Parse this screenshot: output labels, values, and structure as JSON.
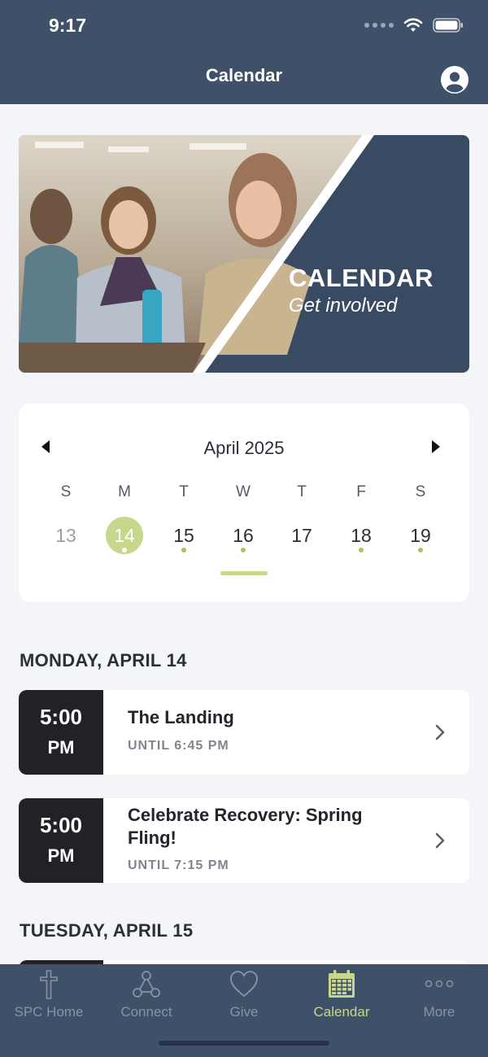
{
  "status_bar": {
    "time": "9:17"
  },
  "nav": {
    "title": "Calendar"
  },
  "banner": {
    "title": "CALENDAR",
    "subtitle": "Get involved"
  },
  "calendar": {
    "month_label": "April 2025",
    "weekdays": [
      "S",
      "M",
      "T",
      "W",
      "T",
      "F",
      "S"
    ],
    "days": [
      {
        "label": "13",
        "muted": true,
        "has_events": false,
        "selected": false
      },
      {
        "label": "14",
        "muted": false,
        "has_events": true,
        "selected": true
      },
      {
        "label": "15",
        "muted": false,
        "has_events": true,
        "selected": false
      },
      {
        "label": "16",
        "muted": false,
        "has_events": true,
        "selected": false
      },
      {
        "label": "17",
        "muted": false,
        "has_events": false,
        "selected": false
      },
      {
        "label": "18",
        "muted": false,
        "has_events": true,
        "selected": false
      },
      {
        "label": "19",
        "muted": false,
        "has_events": true,
        "selected": false
      }
    ]
  },
  "schedule": [
    {
      "day": "MONDAY, APRIL 14",
      "events": [
        {
          "time": "5:00",
          "ampm": "PM",
          "title": "The Landing",
          "until": "UNTIL 6:45 PM"
        },
        {
          "time": "5:00",
          "ampm": "PM",
          "title": "Celebrate Recovery: Spring Fling!",
          "until": "UNTIL 7:15 PM"
        }
      ]
    },
    {
      "day": "TUESDAY, APRIL 15",
      "events": []
    }
  ],
  "tabbar": {
    "items": [
      {
        "label": "SPC Home",
        "icon": "cross-icon",
        "active": false
      },
      {
        "label": "Connect",
        "icon": "connect-icon",
        "active": false
      },
      {
        "label": "Give",
        "icon": "heart-icon",
        "active": false
      },
      {
        "label": "Calendar",
        "icon": "calendar-icon",
        "active": true
      },
      {
        "label": "More",
        "icon": "more-icon",
        "active": false
      }
    ]
  },
  "colors": {
    "header_bg": "#3f5069",
    "accent": "#c7d88c",
    "time_block_bg": "#212225",
    "page_bg": "#f3f5f9"
  }
}
